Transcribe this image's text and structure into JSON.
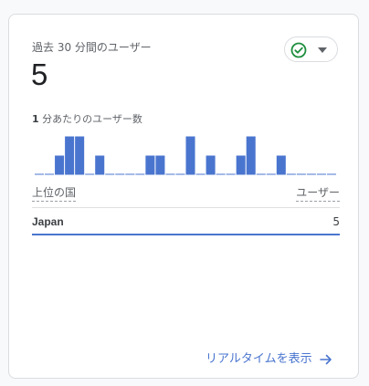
{
  "card": {
    "title": "過去 30 分間のユーザー",
    "value": "5",
    "status_icon": "check-circle-icon",
    "dropdown_icon": "caret-down-icon"
  },
  "per_minute": {
    "label_num": "1",
    "label_text": " 分あたりのユーザー数"
  },
  "chart_data": {
    "type": "bar",
    "title": "",
    "values": [
      0,
      0,
      2,
      4,
      4,
      0,
      2,
      0,
      0,
      0,
      0,
      2,
      2,
      0,
      0,
      4,
      0,
      2,
      0,
      0,
      2,
      4,
      0,
      0,
      2,
      0,
      0,
      0,
      0,
      0
    ],
    "ylim": [
      0,
      4
    ],
    "grid": false,
    "colors": {
      "bar": "#4a75cf",
      "baseline": "#4a75cf"
    }
  },
  "table": {
    "col_country": "上位の国",
    "col_users": "ユーザー",
    "rows": [
      {
        "country": "Japan",
        "users": "5"
      }
    ]
  },
  "footer": {
    "link_label": "リアルタイムを表示",
    "link_icon": "arrow-right-icon"
  },
  "colors": {
    "accent": "#4a75cf",
    "check": "#1e8e3e"
  }
}
